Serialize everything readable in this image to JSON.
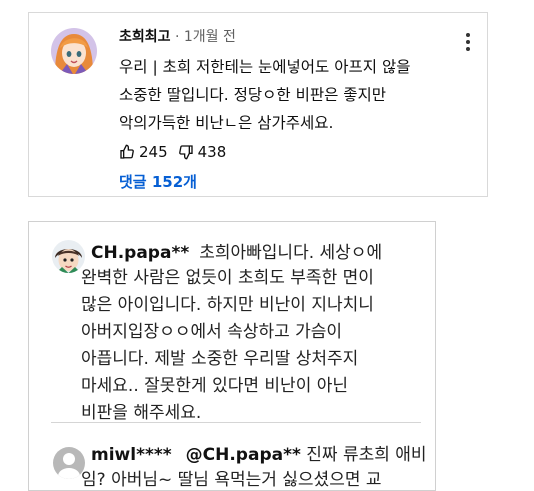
{
  "comment1": {
    "author": "초희최고",
    "separator": " · ",
    "time": "1개월 전",
    "lines": [
      "우리 | 초희 저한테는 눈에넣어도 아프지 않을",
      "소중한 딸입니다. 정당ㅇ한 비판은 좋지만",
      "악의가득한 비난ㄴ은 삼가주세요."
    ],
    "likes": "245",
    "dislikes": "438",
    "replies_label": "댓글 152개"
  },
  "comment2": {
    "author": "CH.papa**",
    "lines": [
      "초희아빠입니다. 세상ㅇ에",
      "완벽한 사람은 없듯이 초희도 부족한 면이",
      "많은 아이입니다. 하지만 비난이 지나치니",
      "아버지입장ㅇㅇ에서 속상하고 가슴이",
      "아픕니다. 제발 소중한 우리딸 상처주지",
      "마세요.. 잘못한게 있다면 비난이 아닌",
      "비판을 해주세요."
    ]
  },
  "comment3": {
    "author": "miwl****",
    "mention": "@CH.papa**",
    "text_first": " 진짜 류초희 애비",
    "text_second": "임? 아버님~ 딸님 욕먹는거 싫으셨으면 교"
  },
  "colors": {
    "link_blue": "#065fd4",
    "border": "#d9d9d9"
  },
  "icons": [
    "thumbs-up-icon",
    "thumbs-down-icon",
    "more-vert-icon",
    "default-avatar-icon"
  ]
}
